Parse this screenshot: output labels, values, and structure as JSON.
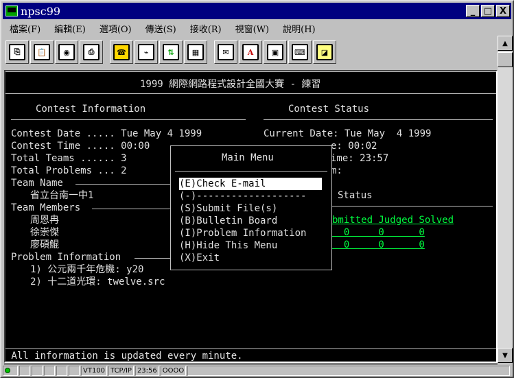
{
  "window": {
    "title": "npsc99",
    "min": "_",
    "max": "□",
    "close": "X"
  },
  "menu": [
    "檔案(F)",
    "編輯(E)",
    "選項(O)",
    "傳送(S)",
    "接收(R)",
    "視窗(W)",
    "說明(H)"
  ],
  "toolbar": [
    {
      "icon": "copy-icon",
      "glyph": "⎘"
    },
    {
      "icon": "paste-icon",
      "glyph": "📋"
    },
    {
      "icon": "camera-icon",
      "glyph": "◉"
    },
    {
      "icon": "print-icon",
      "glyph": "⎙"
    },
    {
      "icon": "phone-icon",
      "glyph": "☎"
    },
    {
      "icon": "disconnect-icon",
      "glyph": "⌁"
    },
    {
      "icon": "transfer-icon",
      "glyph": "⇅"
    },
    {
      "icon": "grid-icon",
      "glyph": "▦"
    },
    {
      "icon": "mail-icon",
      "glyph": "✉"
    },
    {
      "icon": "font-icon",
      "glyph": "A"
    },
    {
      "icon": "monitor-icon",
      "glyph": "▣"
    },
    {
      "icon": "keyboard-icon",
      "glyph": "⌨"
    },
    {
      "icon": "chart-icon",
      "glyph": "◪"
    }
  ],
  "terminal": {
    "header": "1999 網際網路程式設計全國大賽 - 練習",
    "contest_info_title": "Contest Information",
    "contest_status_title": "Contest Status",
    "contest_date": "Contest Date ..... Tue May 4 1999",
    "contest_time": "Contest Time ..... 00:00",
    "total_teams": "Total Teams ...... 3",
    "total_problems": "Total Problems ... 2",
    "team_name_label": "Team Name",
    "team_name": "省立台南一中1",
    "team_members_label": "Team Members",
    "members": [
      "周恩冉",
      "徐崇傑",
      "廖碩鯤"
    ],
    "problem_info_label": "Problem Information",
    "problems": [
      "1) 公元兩千年危機: y20",
      "2) 十二道光環: twelve.src"
    ],
    "current_date": "Current Date: Tue May  4 1999",
    "status_line2": "e: 00:02",
    "status_line3": "ime: 23:57",
    "status_line4": "m:",
    "status_label": "Status",
    "status_cols": "bmitted Judged Solved",
    "status_row1": "  0     0      0",
    "status_row2": "  0     0      0",
    "footer": " All information is updated every minute."
  },
  "main_menu": {
    "title": "Main Menu",
    "items": [
      "(E)Check E-mail",
      "(-)-------------------",
      "(S)Submit File(s)",
      "(B)Bulletin Board",
      "(I)Problem Information",
      "(H)Hide This Menu",
      "(X)Exit"
    ]
  },
  "statusbar": {
    "term": "VT100",
    "proto": "TCP/IP",
    "time": "23:56",
    "leds": "OOOO"
  }
}
